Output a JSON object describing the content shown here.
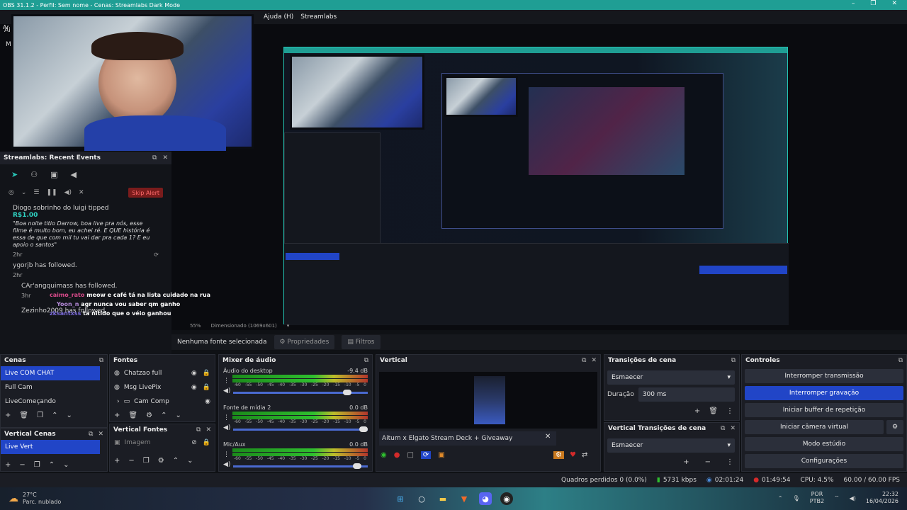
{
  "window": {
    "title": "OBS 31.1.2 - Perfil: Sem nome - Cenas: Streamlabs Dark Mode"
  },
  "menu": [
    "Ajuda (H)",
    "Streamlabs"
  ],
  "menu_left": [
    "Ar",
    "Ai",
    "M"
  ],
  "recent_events": {
    "title": "Streamlabs: Recent Events",
    "skip_alert": "Skip Alert",
    "events": [
      {
        "name": "Diogo sobrinho do luigi",
        "action": "tipped",
        "amount": "R$1.00",
        "message": "\"Boa noite titio Darrow, boa live pra nós, esse filme é muito bom, eu achei ré. E QUE história é essa de que com mil tu vai dar pra cada 1? E eu apoio o santos\"",
        "time": "2hr"
      },
      {
        "name": "ygorjb",
        "action": "has followed.",
        "time": "2hr"
      },
      {
        "name": "CAr'angquimass",
        "action": "has followed.",
        "time": "3hr"
      },
      {
        "name": "Zezinho2009",
        "action": "has followed.",
        "time": ""
      }
    ]
  },
  "chat_overlay": [
    {
      "user": "caimo_rato",
      "text": "meow e café tá na lista cuidado na rua"
    },
    {
      "user": "Yoon_n",
      "text": "agr nunca vou saber qm ganho"
    },
    {
      "user": "zksantxss",
      "text": "ta nitido que o véio ganhou"
    }
  ],
  "preview_bottom": {
    "zoom": "55%",
    "dimension": "Dimensionado (1069x601)"
  },
  "source_bar": {
    "no_source": "Nenhuma fonte selecionada",
    "properties": "Propriedades",
    "filters": "Filtros"
  },
  "scenes": {
    "title": "Cenas",
    "items": [
      "Live COM CHAT",
      "Full Cam",
      "LiveComeçando"
    ],
    "selected": 0
  },
  "vertical_scenes": {
    "title": "Vertical Cenas",
    "items": [
      "Live Vert"
    ],
    "selected": 0
  },
  "sources": {
    "title": "Fontes",
    "items": [
      "Chatzao full",
      "Msg LivePix",
      "Cam Comp"
    ]
  },
  "vertical_sources": {
    "title": "Vertical Fontes",
    "items": [
      "Imagem"
    ]
  },
  "mixer": {
    "title": "Mixer de áudio",
    "ticks": [
      "-60",
      "-55",
      "-50",
      "-45",
      "-40",
      "-35",
      "-30",
      "-25",
      "-20",
      "-15",
      "-10",
      "-5",
      "0"
    ],
    "channels": [
      {
        "name": "Áudio do desktop",
        "db": "-9.4 dB",
        "level": 0.88
      },
      {
        "name": "Fonte de mídia 2",
        "db": "0.0 dB",
        "level": 1.0
      },
      {
        "name": "Mic/Aux",
        "db": "0.0 dB",
        "level": 0.95
      }
    ]
  },
  "vertical": {
    "title": "Vertical",
    "ticker": "Aitum x Elgato Stream Deck + Giveaway"
  },
  "transitions": {
    "title": "Transições de cena",
    "value": "Esmaecer",
    "duration_label": "Duração",
    "duration": "300 ms"
  },
  "vertical_transitions": {
    "title": "Vertical Transições de cena",
    "value": "Esmaecer"
  },
  "controls": {
    "title": "Controles",
    "buttons": [
      "Interromper transmissão",
      "Interromper gravação",
      "Iniciar buffer de repetição",
      "Iniciar câmera virtual",
      "Modo estúdio",
      "Configurações"
    ],
    "active": 1
  },
  "status": {
    "dropped": "Quadros perdidos 0 (0.0%)",
    "bitrate": "5731 kbps",
    "stream_time": "02:01:24",
    "rec_time": "01:49:54",
    "cpu": "CPU: 4.5%",
    "fps": "60.00 / 60.00 FPS"
  },
  "taskbar": {
    "temp": "27°C",
    "weather": "Parc. nublado",
    "lang1": "POR",
    "lang2": "PTB2",
    "time": "22:32",
    "date": "16/04/2026"
  },
  "colors": {
    "accent": "#2145c7",
    "teal": "#1f9e94",
    "record": "#d42a2a"
  }
}
